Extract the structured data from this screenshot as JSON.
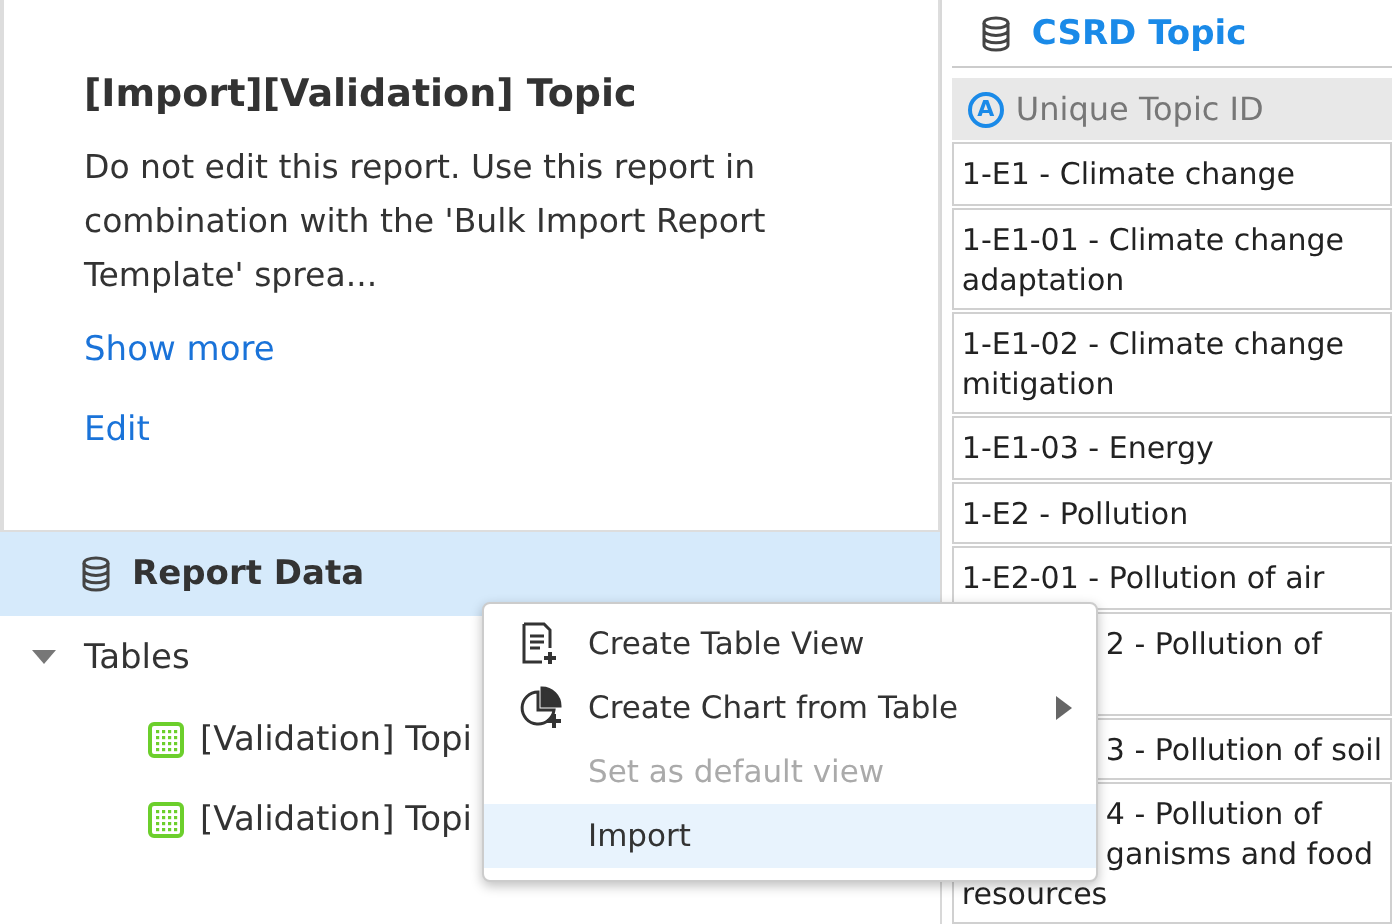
{
  "report": {
    "title": "[Import][Validation] Topic",
    "description": "Do not edit this report. Use this report in combination with the 'Bulk Import Report Template' sprea...",
    "show_more": "Show more",
    "edit": "Edit"
  },
  "tree": {
    "root": {
      "label": "Report Data",
      "selected": true
    },
    "group": {
      "label": "Tables",
      "expanded": true
    },
    "items": [
      {
        "label": "[Validation] Topi"
      },
      {
        "label": "[Validation] Topi"
      }
    ]
  },
  "preview": {
    "title": "CSRD Topic",
    "column": "Unique Topic ID",
    "column_badge": "A",
    "rows": [
      {
        "lines": [
          {
            "text": "1-E1 - Climate change",
            "covered": false
          }
        ]
      },
      {
        "lines": [
          {
            "text": "1-E1-01 - Climate change",
            "covered": false
          },
          {
            "text": "adaptation",
            "covered": false
          }
        ]
      },
      {
        "lines": [
          {
            "text": "1-E1-02 - Climate change",
            "covered": false
          },
          {
            "text": "mitigation",
            "covered": false
          }
        ]
      },
      {
        "lines": [
          {
            "text": "1-E1-03 - Energy",
            "covered": false
          }
        ]
      },
      {
        "lines": [
          {
            "text": "1-E2 - Pollution",
            "covered": false
          }
        ]
      },
      {
        "lines": [
          {
            "text": "1-E2-01 - Pollution of air",
            "covered": false
          }
        ]
      },
      {
        "kind": "tall",
        "lines": [
          {
            "text": "2 - Pollution of",
            "covered": true
          }
        ]
      },
      {
        "lines": [
          {
            "text": "3 - Pollution of soil",
            "covered": true
          }
        ]
      },
      {
        "lines": [
          {
            "text": "4 - Pollution of",
            "covered": true
          },
          {
            "text": "ganisms and food",
            "covered": true
          },
          {
            "text": "resources",
            "covered": false
          }
        ]
      }
    ]
  },
  "context_menu": {
    "items": [
      {
        "kind": "table",
        "label": "Create Table View",
        "disabled": false,
        "selected": false,
        "submenu": false
      },
      {
        "kind": "chart",
        "label": "Create Chart from Table",
        "disabled": false,
        "selected": false,
        "submenu": true
      },
      {
        "kind": "plain",
        "label": "Set as default view",
        "disabled": true,
        "selected": false,
        "submenu": false
      },
      {
        "kind": "plain",
        "label": "Import",
        "disabled": false,
        "selected": true,
        "submenu": false
      }
    ]
  }
}
